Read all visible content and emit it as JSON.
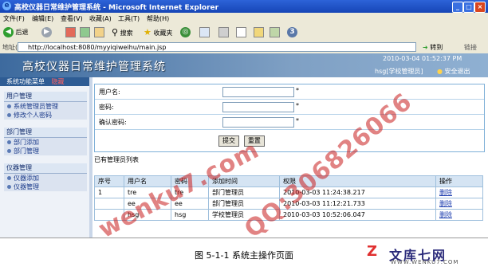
{
  "browser": {
    "title": "高校仪器日常维护管理系统 - Microsoft Internet Explorer",
    "menu": [
      "文件(F)",
      "编辑(E)",
      "查看(V)",
      "收藏(A)",
      "工具(T)",
      "帮助(H)"
    ],
    "toolbar": {
      "back": "后退",
      "search": "搜索",
      "favorites": "收藏夹"
    },
    "address_label": "地址(D)",
    "address": "http://localhost:8080/myyiqiweihu/main.jsp",
    "go_label": "转到",
    "links_label": "链接"
  },
  "app": {
    "title": "高校仪器日常维护管理系统",
    "timestamp": "2010-03-04 01:52:37 PM",
    "user": "hsg[学校管理员]",
    "logout": "安全退出"
  },
  "sidebar": {
    "head_label": "系统功能菜单",
    "head_mark": "隐藏",
    "groups": [
      {
        "title": "用户管理",
        "items": [
          "系统管理员管理",
          "修改个人密码"
        ]
      },
      {
        "title": "部门管理",
        "items": [
          "部门添加",
          "部门管理"
        ]
      },
      {
        "title": "仪器管理",
        "items": [
          "仪器添加",
          "仪器管理"
        ]
      }
    ]
  },
  "form": {
    "username_label": "用户名:",
    "password_label": "密码:",
    "confirm_label": "确认密码:",
    "required_mark": "*",
    "submit": "提交",
    "reset": "重置"
  },
  "admins": {
    "section_title": "已有管理员列表",
    "headers": [
      "序号",
      "用户名",
      "密码",
      "添加时间",
      "权限",
      "操作"
    ],
    "rows": [
      {
        "no": "1",
        "user": "tre",
        "pwd": "tre",
        "time": "部门管理员",
        "perm": "2010-03-03 11:24:38.217",
        "op": "删除"
      },
      {
        "no": "",
        "user": "ee",
        "pwd": "ee",
        "time": "部门管理员",
        "perm": "2010-03-03 11:12:21.733",
        "op": "删除"
      },
      {
        "no": "",
        "user": "hsg",
        "pwd": "hsg",
        "time": "学校管理员",
        "perm": "2010-03-03 10:52:06.047",
        "op": "删除"
      }
    ]
  },
  "caption": "图 5-1-1 系统主操作页面",
  "watermarks": [
    "wenku7.com",
    "QQ:306826066"
  ],
  "logo": {
    "mark": "Z",
    "text": "文库七网",
    "url": "WWW.WENKU7.COM"
  }
}
